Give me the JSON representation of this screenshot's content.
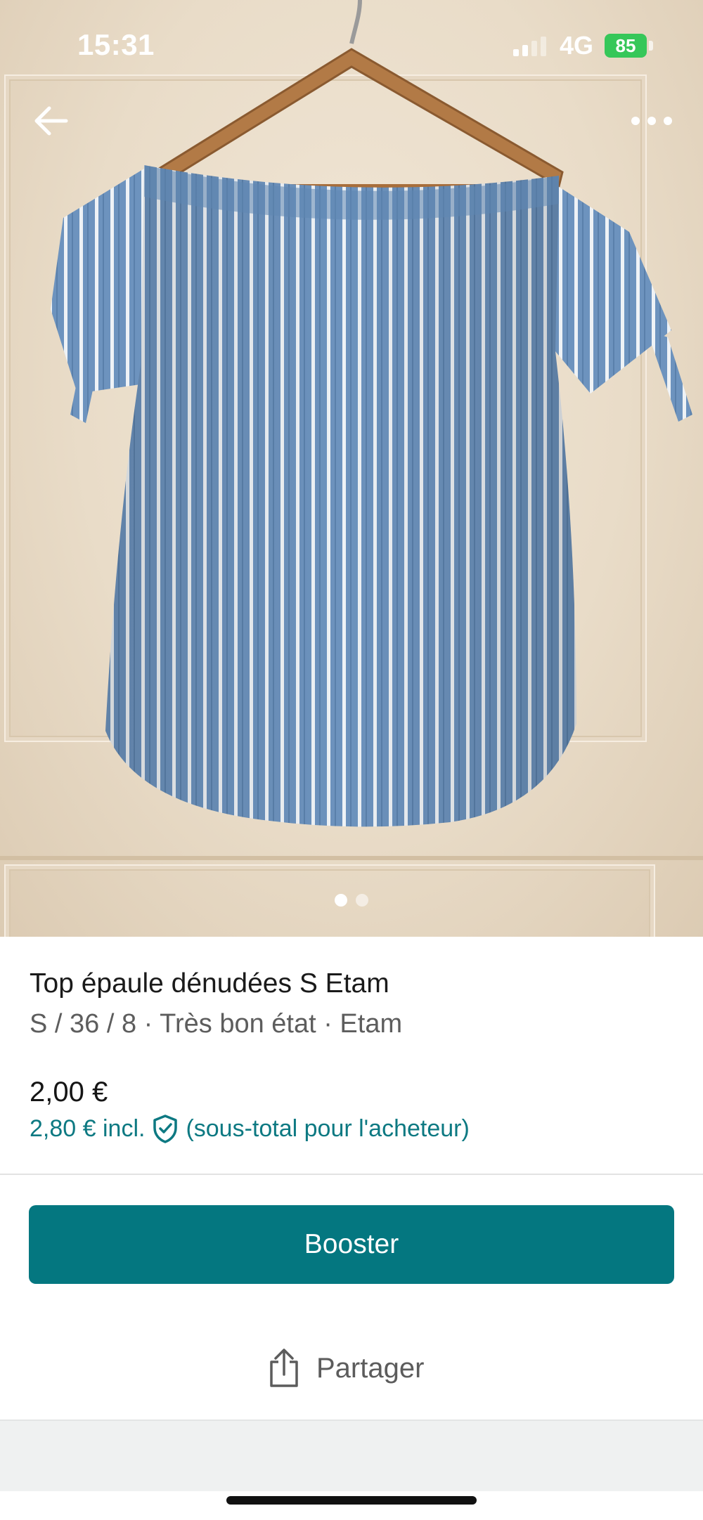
{
  "status_bar": {
    "time": "15:31",
    "network": "4G",
    "battery": "85"
  },
  "nav": {
    "back_icon": "arrow-left-icon",
    "more_icon": "more-horizontal-icon"
  },
  "gallery": {
    "total_images": 2,
    "active_index": 0
  },
  "item": {
    "title": "Top épaule dénudées S Etam",
    "subtitle": "S / 36 / 8 · Très bon état · Etam",
    "price": "2,00 €",
    "price_incl": "2,80 € incl.",
    "protection_icon": "shield-check-icon",
    "price_incl_note": "(sous-total pour l'acheteur)"
  },
  "actions": {
    "boost_label": "Booster",
    "share_label": "Partager",
    "share_icon": "share-icon"
  },
  "colors": {
    "accent": "#047780",
    "accent_text": "#0d7982",
    "battery": "#36c759"
  }
}
